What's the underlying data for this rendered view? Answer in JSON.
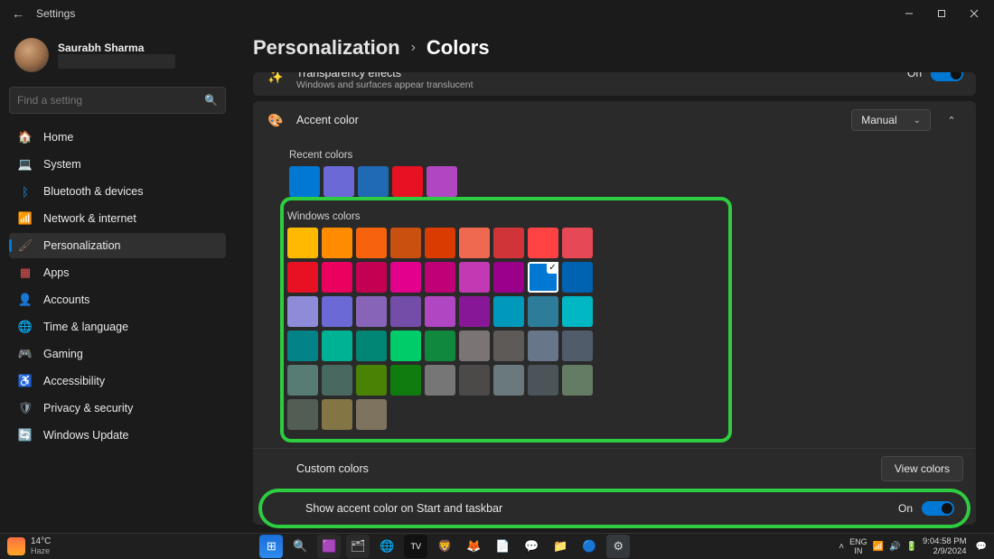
{
  "window": {
    "title": "Settings"
  },
  "user": {
    "name": "Saurabh Sharma"
  },
  "search": {
    "placeholder": "Find a setting"
  },
  "nav": {
    "home": "Home",
    "system": "System",
    "bluetooth": "Bluetooth & devices",
    "network": "Network & internet",
    "personalization": "Personalization",
    "apps": "Apps",
    "accounts": "Accounts",
    "time": "Time & language",
    "gaming": "Gaming",
    "accessibility": "Accessibility",
    "privacy": "Privacy & security",
    "update": "Windows Update"
  },
  "breadcrumb": {
    "parent": "Personalization",
    "current": "Colors"
  },
  "transparency": {
    "title": "Transparency effects",
    "subtitle": "Windows and surfaces appear translucent",
    "state": "On"
  },
  "accent": {
    "title": "Accent color",
    "mode": "Manual",
    "recent_label": "Recent colors",
    "recent": [
      "#0078d4",
      "#6b69d6",
      "#1f6ab3",
      "#e81123",
      "#b146c2"
    ],
    "windows_label": "Windows colors",
    "grid": [
      [
        "#ffb900",
        "#ff8c00",
        "#f7630c",
        "#ca5010",
        "#da3b01",
        "#ef6950",
        "#d13438",
        "#ff4343",
        "#e74856"
      ],
      [
        "#e81123",
        "#ea005e",
        "#c30052",
        "#e3008c",
        "#bf0077",
        "#c239b3",
        "#9a0089",
        "#0078d4",
        "#0063b1"
      ],
      [
        "#8e8cd8",
        "#6b69d6",
        "#8764b8",
        "#744da9",
        "#b146c2",
        "#881798",
        "#0099bc",
        "#2d7d9a",
        "#00b7c3"
      ],
      [
        "#038387",
        "#00b294",
        "#018574",
        "#00cc6a",
        "#10893e",
        "#7a7574",
        "#5d5a58",
        "#68768a",
        "#515c6b"
      ],
      [
        "#567c73",
        "#486860",
        "#498205",
        "#107c10",
        "#767676",
        "#4c4a48",
        "#69797e",
        "#4a5459",
        "#647c64"
      ],
      [
        "#525e54",
        "#847545",
        "#7e735f"
      ]
    ],
    "selected": "#0078d4"
  },
  "custom": {
    "label": "Custom colors",
    "view_btn": "View colors"
  },
  "show_accent_taskbar": {
    "label": "Show accent color on Start and taskbar",
    "state": "On"
  },
  "taskbar": {
    "weather_temp": "14°C",
    "weather_cond": "Haze",
    "lang1": "ENG",
    "lang2": "IN",
    "time": "9:04:58 PM",
    "date": "2/9/2024"
  }
}
